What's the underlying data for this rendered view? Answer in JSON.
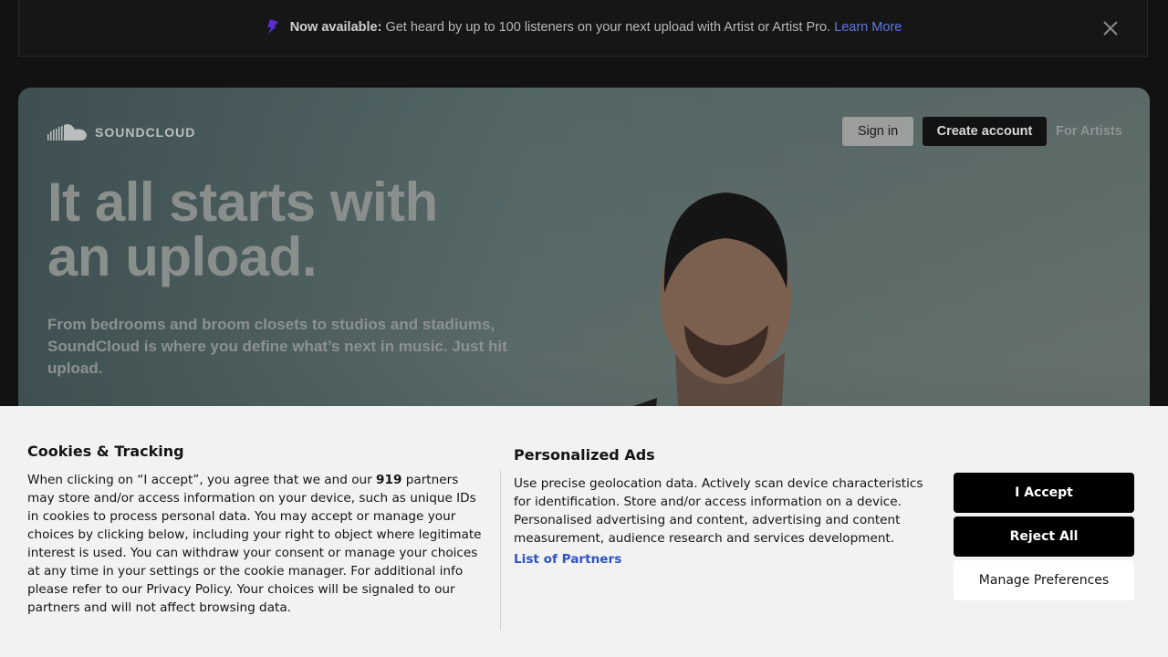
{
  "promo": {
    "strong": "Now available:",
    "text": " Get heard by up to 100 listeners on your next upload with Artist or Artist Pro. ",
    "link": "Learn More",
    "icon": "bolt-icon",
    "close_icon": "close-icon"
  },
  "header": {
    "logo_text": "SOUNDCLOUD",
    "signin": "Sign in",
    "create": "Create account",
    "for_artists": "For Artists"
  },
  "hero": {
    "title_line1": "It all starts with",
    "title_line2": "an upload.",
    "subtitle": "From bedrooms and broom closets to studios and stadiums, SoundCloud is where you define what’s next in music. Just hit upload."
  },
  "cookies": {
    "title": "Cookies & Tracking",
    "body_pre": "When clicking on “I accept”, you agree that we and our ",
    "partners_count": "919",
    "body_post": " partners may store and/or access information on your device, such as unique IDs in cookies to process personal data. You may accept or manage your choices by clicking below, including your right to object where legitimate interest is used. You can withdraw your consent or manage your choices at any time in your settings or the cookie manager. For additional info please refer to our Privacy Policy. Your choices will be signaled to our partners and will not affect browsing data.",
    "ads_title": "Personalized Ads",
    "ads_body": "Use precise geolocation data. Actively scan device characteristics for identification. Store and/or access information on a device. Personalised advertising and content, advertising and content measurement, audience research and services development.",
    "partners_link": "List of Partners",
    "accept": "I Accept",
    "reject": "Reject All",
    "manage": "Manage Preferences"
  },
  "colors": {
    "accent_link": "#5f78e0",
    "promo_icon": "#5a2cd6",
    "button_dark": "#000000"
  }
}
